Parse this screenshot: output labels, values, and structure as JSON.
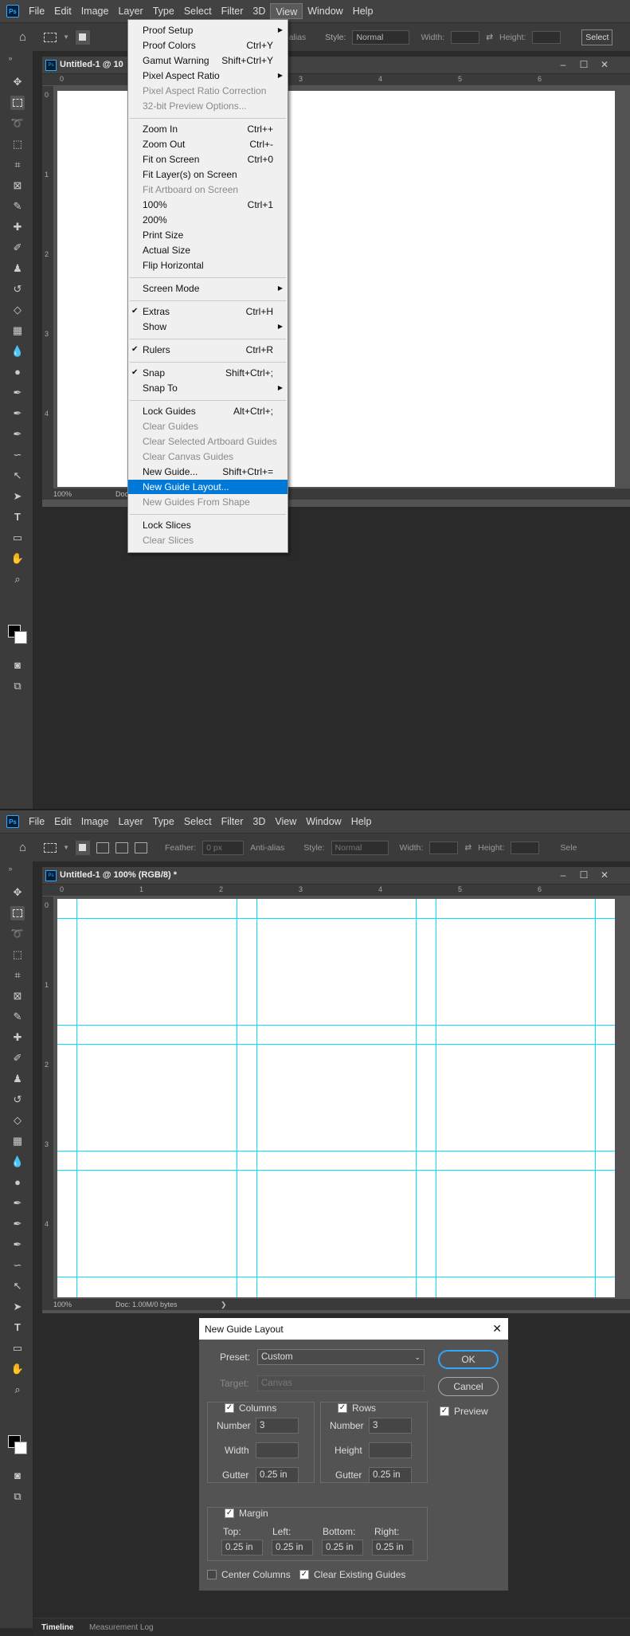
{
  "menubar": {
    "logo": "Ps",
    "items": [
      "File",
      "Edit",
      "Image",
      "Layer",
      "Type",
      "Select",
      "Filter",
      "3D",
      "View",
      "Window",
      "Help"
    ]
  },
  "options": {
    "antialias": "Anti-alias",
    "style_label": "Style:",
    "style_value": "Normal",
    "width_label": "Width:",
    "height_label": "Height:",
    "feather_label": "Feather:",
    "feather_value": "0 px",
    "select_btn_top": "Select",
    "select_btn_bottom": "Sele"
  },
  "doc_top": {
    "title": "Untitled-1 @ 10",
    "zoom": "100%",
    "doc_info": "Doc"
  },
  "doc_bottom": {
    "title": "Untitled-1 @ 100% (RGB/8) *",
    "zoom": "100%",
    "doc_info": "Doc: 1.00M/0 bytes",
    "status_arrow": "❯"
  },
  "ruler": {
    "h_labels_top": [
      "0",
      "3",
      "4",
      "5",
      "6"
    ],
    "h_labels_bottom": [
      "0",
      "1",
      "2",
      "3",
      "4",
      "5",
      "6"
    ],
    "v_labels": [
      "0",
      "1",
      "2",
      "3",
      "4"
    ]
  },
  "view_menu": {
    "items": [
      {
        "label": "Proof Setup",
        "shortcut": "",
        "submenu": true,
        "disabled": false,
        "checked": false
      },
      {
        "label": "Proof Colors",
        "shortcut": "Ctrl+Y",
        "submenu": false,
        "disabled": false,
        "checked": false
      },
      {
        "label": "Gamut Warning",
        "shortcut": "Shift+Ctrl+Y",
        "submenu": false,
        "disabled": false,
        "checked": false
      },
      {
        "label": "Pixel Aspect Ratio",
        "shortcut": "",
        "submenu": true,
        "disabled": false,
        "checked": false
      },
      {
        "label": "Pixel Aspect Ratio Correction",
        "shortcut": "",
        "submenu": false,
        "disabled": true,
        "checked": false
      },
      {
        "label": "32-bit Preview Options...",
        "shortcut": "",
        "submenu": false,
        "disabled": true,
        "checked": false
      },
      {
        "label": "Zoom In",
        "shortcut": "Ctrl++",
        "submenu": false,
        "disabled": false,
        "checked": false
      },
      {
        "label": "Zoom Out",
        "shortcut": "Ctrl+-",
        "submenu": false,
        "disabled": false,
        "checked": false
      },
      {
        "label": "Fit on Screen",
        "shortcut": "Ctrl+0",
        "submenu": false,
        "disabled": false,
        "checked": false
      },
      {
        "label": "Fit Layer(s) on Screen",
        "shortcut": "",
        "submenu": false,
        "disabled": false,
        "checked": false
      },
      {
        "label": "Fit Artboard on Screen",
        "shortcut": "",
        "submenu": false,
        "disabled": true,
        "checked": false
      },
      {
        "label": "100%",
        "shortcut": "Ctrl+1",
        "submenu": false,
        "disabled": false,
        "checked": false
      },
      {
        "label": "200%",
        "shortcut": "",
        "submenu": false,
        "disabled": false,
        "checked": false
      },
      {
        "label": "Print Size",
        "shortcut": "",
        "submenu": false,
        "disabled": false,
        "checked": false
      },
      {
        "label": "Actual Size",
        "shortcut": "",
        "submenu": false,
        "disabled": false,
        "checked": false
      },
      {
        "label": "Flip Horizontal",
        "shortcut": "",
        "submenu": false,
        "disabled": false,
        "checked": false
      },
      {
        "label": "Screen Mode",
        "shortcut": "",
        "submenu": true,
        "disabled": false,
        "checked": false
      },
      {
        "label": "Extras",
        "shortcut": "Ctrl+H",
        "submenu": false,
        "disabled": false,
        "checked": true
      },
      {
        "label": "Show",
        "shortcut": "",
        "submenu": true,
        "disabled": false,
        "checked": false
      },
      {
        "label": "Rulers",
        "shortcut": "Ctrl+R",
        "submenu": false,
        "disabled": false,
        "checked": true
      },
      {
        "label": "Snap",
        "shortcut": "Shift+Ctrl+;",
        "submenu": false,
        "disabled": false,
        "checked": true
      },
      {
        "label": "Snap To",
        "shortcut": "",
        "submenu": true,
        "disabled": false,
        "checked": false
      },
      {
        "label": "Lock Guides",
        "shortcut": "Alt+Ctrl+;",
        "submenu": false,
        "disabled": false,
        "checked": false
      },
      {
        "label": "Clear Guides",
        "shortcut": "",
        "submenu": false,
        "disabled": true,
        "checked": false
      },
      {
        "label": "Clear Selected Artboard Guides",
        "shortcut": "",
        "submenu": false,
        "disabled": true,
        "checked": false
      },
      {
        "label": "Clear Canvas Guides",
        "shortcut": "",
        "submenu": false,
        "disabled": true,
        "checked": false
      },
      {
        "label": "New Guide...",
        "shortcut": "Shift+Ctrl+=",
        "submenu": false,
        "disabled": false,
        "checked": false
      },
      {
        "label": "New Guide Layout...",
        "shortcut": "",
        "submenu": false,
        "disabled": false,
        "checked": false,
        "highlighted": true
      },
      {
        "label": "New Guides From Shape",
        "shortcut": "",
        "submenu": false,
        "disabled": true,
        "checked": false
      },
      {
        "label": "Lock Slices",
        "shortcut": "",
        "submenu": false,
        "disabled": false,
        "checked": false
      },
      {
        "label": "Clear Slices",
        "shortcut": "",
        "submenu": false,
        "disabled": true,
        "checked": false
      }
    ]
  },
  "dialog": {
    "title": "New Guide Layout",
    "preset_label": "Preset:",
    "preset_value": "Custom",
    "target_label": "Target:",
    "target_value": "Canvas",
    "columns_label": "Columns",
    "columns_checked": true,
    "rows_label": "Rows",
    "rows_checked": true,
    "number_label": "Number",
    "width_label": "Width",
    "height_label": "Height",
    "gutter_label": "Gutter",
    "col_number": "3",
    "col_width": "",
    "col_gutter": "0.25 in",
    "row_number": "3",
    "row_height": "",
    "row_gutter": "0.25 in",
    "margin_label": "Margin",
    "margin_checked": true,
    "top_label": "Top:",
    "left_label": "Left:",
    "bottom_label": "Bottom:",
    "right_label": "Right:",
    "top_value": "0.25 in",
    "left_value": "0.25 in",
    "bottom_value": "0.25 in",
    "right_value": "0.25 in",
    "center_columns_label": "Center Columns",
    "center_columns_checked": false,
    "clear_guides_label": "Clear Existing Guides",
    "clear_guides_checked": true,
    "ok_label": "OK",
    "cancel_label": "Cancel",
    "preview_label": "Preview",
    "preview_checked": true,
    "close_glyph": "✕"
  },
  "panel_tabs": [
    "Timeline",
    "Measurement Log"
  ],
  "colors": {
    "guide": "#00e5ff",
    "highlight": "#0078d7",
    "ps_blue": "#31a8ff"
  }
}
